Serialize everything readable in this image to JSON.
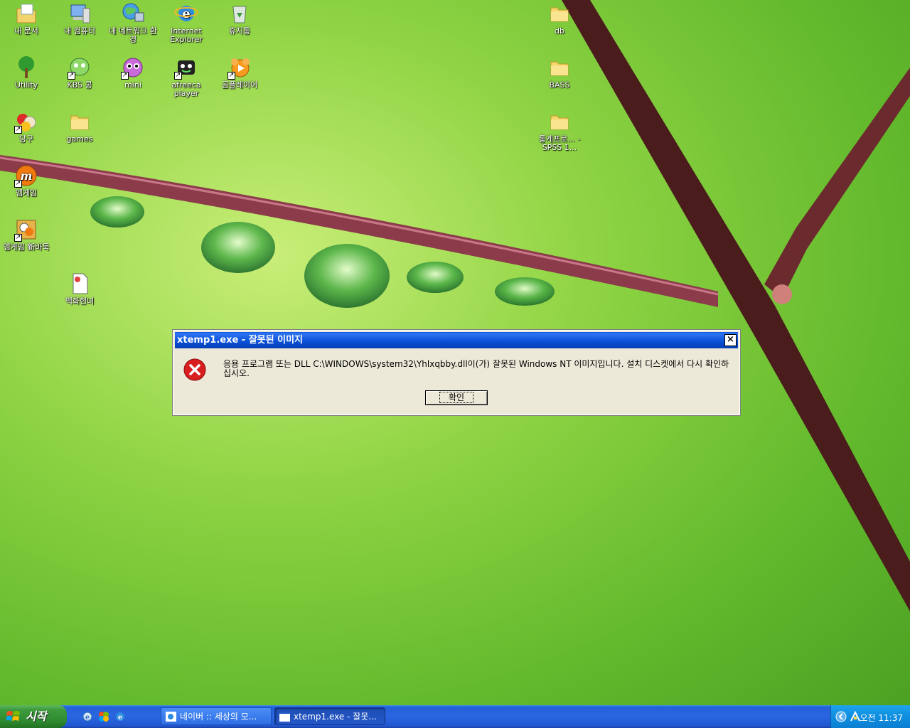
{
  "desktop": {
    "icons": [
      {
        "label": "내 문서",
        "icon": "my-documents-icon"
      },
      {
        "label": "내 컴퓨터",
        "icon": "my-computer-icon"
      },
      {
        "label": "내 네트워크 환경",
        "icon": "network-icon"
      },
      {
        "label": "Internet Explorer",
        "icon": "ie-icon"
      },
      {
        "label": "휴지통",
        "icon": "recycle-bin-icon"
      },
      {
        "label": "Utility",
        "icon": "tree-icon"
      },
      {
        "label": "KBS 콩",
        "icon": "kbs-kong-icon"
      },
      {
        "label": "mini",
        "icon": "mini-icon"
      },
      {
        "label": "afreeca player",
        "icon": "afreeca-icon"
      },
      {
        "label": "곰플레이어",
        "icon": "gom-player-icon"
      },
      {
        "label": "당구",
        "icon": "billiards-icon"
      },
      {
        "label": "games",
        "icon": "folder-icon"
      },
      {
        "label": "엠게임",
        "icon": "mgame-icon"
      },
      {
        "label": "엠게임 新바둑",
        "icon": "baduk-icon"
      },
      {
        "label": "백화현녀",
        "icon": "document-icon"
      },
      {
        "label": "db",
        "icon": "folder-icon"
      },
      {
        "label": "BASS",
        "icon": "folder-icon"
      },
      {
        "label": "통계프로... - SPSS 1...",
        "icon": "folder-icon"
      }
    ]
  },
  "dialog": {
    "title": "xtemp1.exe - 잘못된 이미지",
    "message": "응용 프로그램 또는 DLL C:\\WINDOWS\\system32\\Yhlxqbby.dll이(가) 잘못된 Windows NT 이미지입니다. 설치 디스켓에서 다시 확인하십시오.",
    "ok_label": "확인",
    "close_label": "×"
  },
  "taskbar": {
    "start_label": "시작",
    "tasks": [
      {
        "label": "네이버 :: 세상의 모..."
      },
      {
        "label": "xtemp1.exe - 잘못..."
      }
    ],
    "clock": "오전 11:37"
  },
  "colors": {
    "title_bar": "#0a4fd6",
    "taskbar": "#2457c8",
    "start_green": "#3c9b3c",
    "tray": "#0f8ee0"
  }
}
